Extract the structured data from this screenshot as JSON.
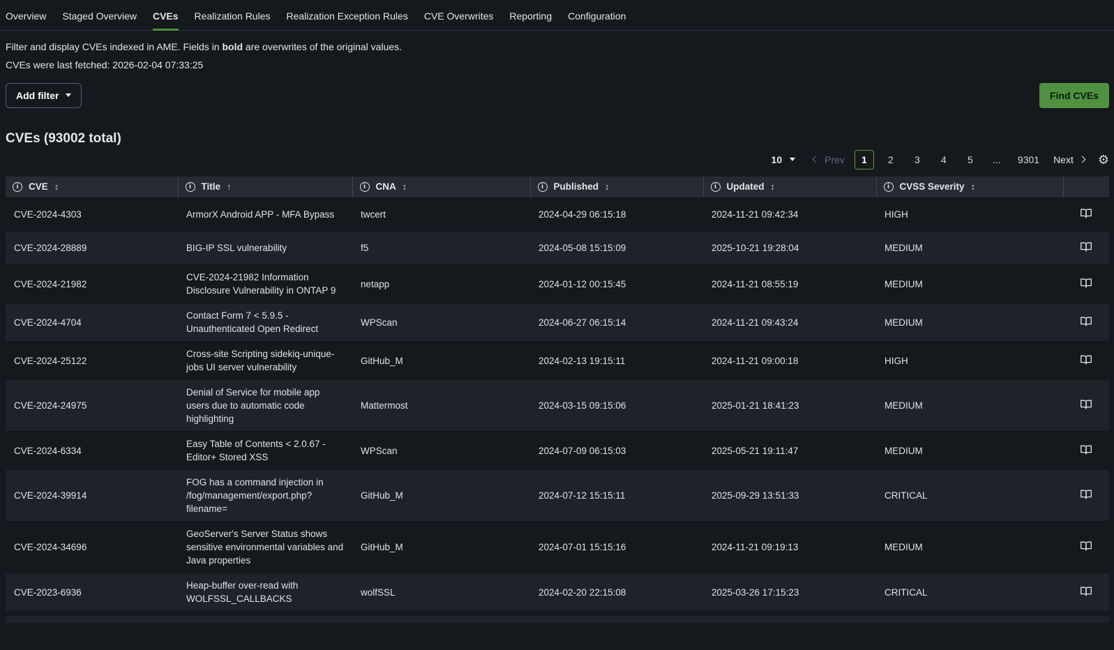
{
  "tabs": [
    {
      "label": "Overview",
      "active": false
    },
    {
      "label": "Staged Overview",
      "active": false
    },
    {
      "label": "CVEs",
      "active": true
    },
    {
      "label": "Realization Rules",
      "active": false
    },
    {
      "label": "Realization Exception Rules",
      "active": false
    },
    {
      "label": "CVE Overwrites",
      "active": false
    },
    {
      "label": "Reporting",
      "active": false
    },
    {
      "label": "Configuration",
      "active": false
    }
  ],
  "intro": {
    "line1_prefix": "Filter and display CVEs indexed in AME. Fields in ",
    "line1_bold": "bold",
    "line1_suffix": " are overwrites of the original values.",
    "line2": "CVEs were last fetched: 2026-02-04 07:33:25"
  },
  "toolbar": {
    "add_filter_label": "Add filter",
    "find_cves_label": "Find CVEs"
  },
  "heading": {
    "title": "CVEs (93002 total)"
  },
  "pagination": {
    "page_size": "10",
    "prev_label": "Prev",
    "next_label": "Next",
    "pages": [
      "1",
      "2",
      "3",
      "4",
      "5",
      "...",
      "9301"
    ],
    "active_page": "1",
    "gear_icon": "⚙"
  },
  "table": {
    "columns": [
      {
        "label": "CVE",
        "sort_icon": "↕"
      },
      {
        "label": "Title",
        "sort_icon": "↑"
      },
      {
        "label": "CNA",
        "sort_icon": "↕"
      },
      {
        "label": "Published",
        "sort_icon": "↕"
      },
      {
        "label": "Updated",
        "sort_icon": "↕"
      },
      {
        "label": "CVSS Severity",
        "sort_icon": "↕"
      }
    ],
    "rows": [
      {
        "cve": "CVE-2024-4303",
        "title": "ArmorX Android APP - MFA Bypass",
        "cna": "twcert",
        "published": "2024-04-29 06:15:18",
        "updated": "2024-11-21 09:42:34",
        "severity": "HIGH"
      },
      {
        "cve": "CVE-2024-28889",
        "title": "BIG-IP SSL vulnerability",
        "cna": "f5",
        "published": "2024-05-08 15:15:09",
        "updated": "2025-10-21 19:28:04",
        "severity": "MEDIUM"
      },
      {
        "cve": "CVE-2024-21982",
        "title": "CVE-2024-21982 Information Disclosure Vulnerability in ONTAP 9",
        "cna": "netapp",
        "published": "2024-01-12 00:15:45",
        "updated": "2024-11-21 08:55:19",
        "severity": "MEDIUM"
      },
      {
        "cve": "CVE-2024-4704",
        "title": "Contact Form 7 < 5.9.5 - Unauthenticated Open Redirect",
        "cna": "WPScan",
        "published": "2024-06-27 06:15:14",
        "updated": "2024-11-21 09:43:24",
        "severity": "MEDIUM"
      },
      {
        "cve": "CVE-2024-25122",
        "title": "Cross-site Scripting sidekiq-unique-jobs UI server vulnerability",
        "cna": "GitHub_M",
        "published": "2024-02-13 19:15:11",
        "updated": "2024-11-21 09:00:18",
        "severity": "HIGH"
      },
      {
        "cve": "CVE-2024-24975",
        "title": "Denial of Service for mobile app users due to automatic code highlighting",
        "cna": "Mattermost",
        "published": "2024-03-15 09:15:06",
        "updated": "2025-01-21 18:41:23",
        "severity": "MEDIUM"
      },
      {
        "cve": "CVE-2024-6334",
        "title": "Easy Table of Contents < 2.0.67 - Editor+ Stored XSS",
        "cna": "WPScan",
        "published": "2024-07-09 06:15:03",
        "updated": "2025-05-21 19:11:47",
        "severity": "MEDIUM"
      },
      {
        "cve": "CVE-2024-39914",
        "title": "FOG has a command injection in /fog/management/export.php?filename=",
        "cna": "GitHub_M",
        "published": "2024-07-12 15:15:11",
        "updated": "2025-09-29 13:51:33",
        "severity": "CRITICAL"
      },
      {
        "cve": "CVE-2024-34696",
        "title": "GeoServer's Server Status shows sensitive environmental variables and Java properties",
        "cna": "GitHub_M",
        "published": "2024-07-01 15:15:16",
        "updated": "2024-11-21 09:19:13",
        "severity": "MEDIUM"
      },
      {
        "cve": "CVE-2023-6936",
        "title": "Heap-buffer over-read with WOLFSSL_CALLBACKS",
        "cna": "wolfSSL",
        "published": "2024-02-20 22:15:08",
        "updated": "2025-03-26 17:15:23",
        "severity": "CRITICAL"
      }
    ]
  },
  "colors": {
    "accent_green": "#4f9140",
    "active_page_border": "#57a03c",
    "page_bg": "#15181d",
    "row_alt_bg": "#1e232a",
    "header_bg": "#262b33"
  }
}
